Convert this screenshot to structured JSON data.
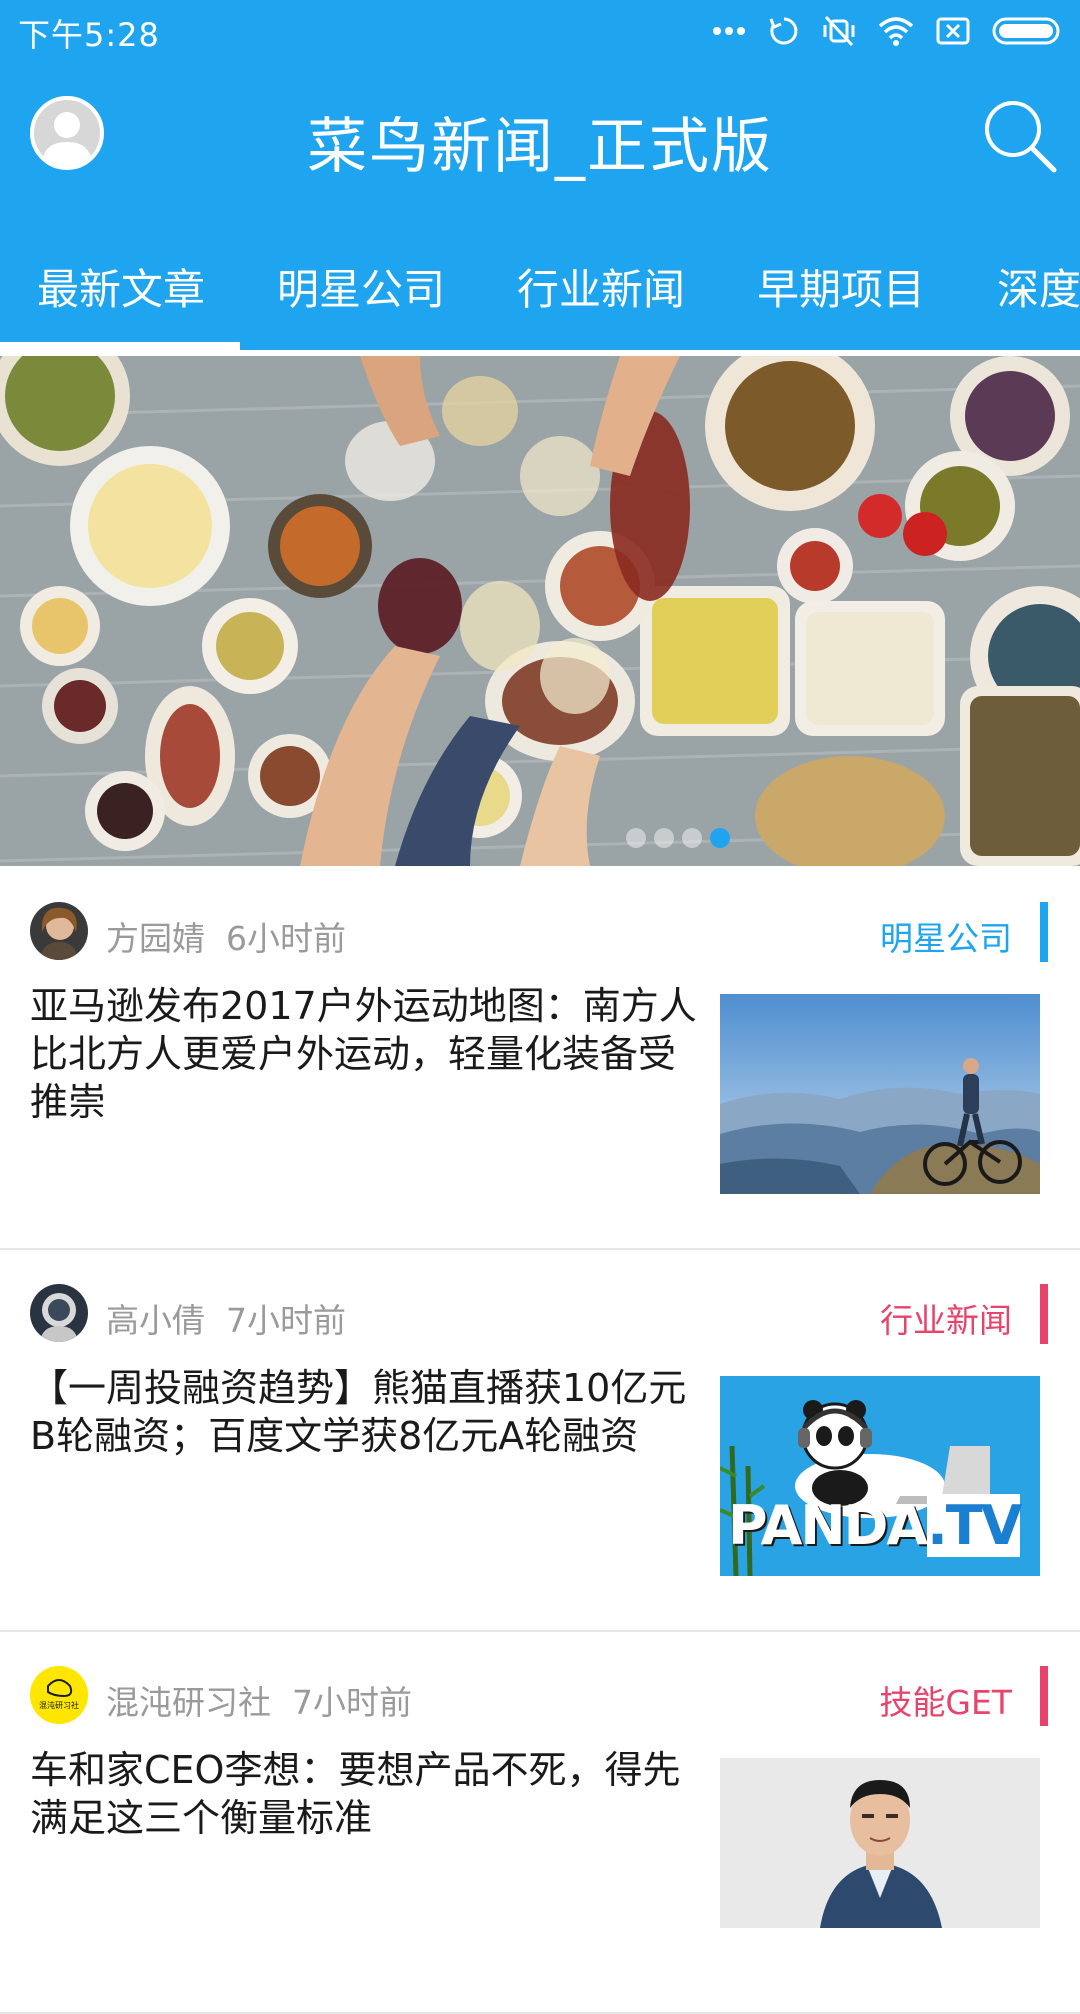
{
  "status_bar": {
    "time": "下午5:28",
    "icons": [
      "more-dots-icon",
      "sync-icon",
      "mute-vibrate-icon",
      "wifi-icon",
      "no-sim-icon",
      "battery-icon"
    ]
  },
  "app_bar": {
    "title": "菜鸟新闻_正式版",
    "left_icon": "profile-icon",
    "right_icon": "search-icon"
  },
  "tabs": [
    {
      "label": "最新文章",
      "selected": true
    },
    {
      "label": "明星公司",
      "selected": false
    },
    {
      "label": "行业新闻",
      "selected": false
    },
    {
      "label": "早期项目",
      "selected": false
    },
    {
      "label": "深度",
      "selected": false
    }
  ],
  "banner": {
    "slide_count": 4,
    "active_index": 3
  },
  "articles": [
    {
      "author": "方园婧",
      "time": "6小时前",
      "category": "明星公司",
      "category_color": "#1fa5f0",
      "title": "亚马逊发布2017户外运动地图：南方人比北方人更爱户外运动，轻量化装备受推崇"
    },
    {
      "author": "高小倩",
      "time": "7小时前",
      "category": "行业新闻",
      "category_color": "#e8436a",
      "title": "【一周投融资趋势】熊猫直播获10亿元B轮融资；百度文学获8亿元A轮融资"
    },
    {
      "author": "混沌研习社",
      "time": "7小时前",
      "category": "技能GET",
      "category_color": "#e8436a",
      "title": "车和家CEO李想：要想产品不死，得先满足这三个衡量标准",
      "avatar_text": "混沌研习社"
    }
  ],
  "thumb_texts": {
    "panda": "PANDA",
    "tv": ".TV"
  },
  "colors": {
    "primary": "#1fa5f0",
    "accent_red": "#e8436a",
    "meta_gray": "#9a9a9a"
  }
}
